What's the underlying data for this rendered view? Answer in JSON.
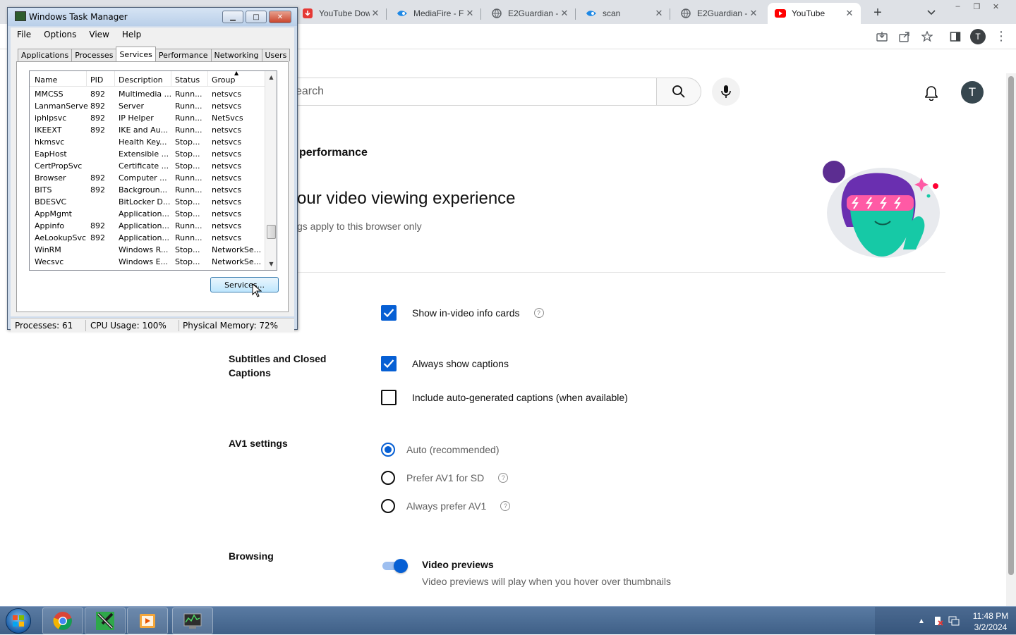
{
  "browser": {
    "tabs": [
      {
        "label": "YouTube Dow",
        "icon": "youtube-downloader-icon"
      },
      {
        "label": "MediaFire - F",
        "icon": "mediafire-icon"
      },
      {
        "label": "E2Guardian -",
        "icon": "globe-icon"
      },
      {
        "label": "scan",
        "icon": "mediafire-icon"
      },
      {
        "label": "E2Guardian -",
        "icon": "globe-icon"
      },
      {
        "label": "YouTube",
        "icon": "youtube-icon",
        "active": true
      }
    ],
    "new_tab": "+",
    "profile_initial": "T",
    "window_controls": [
      "–",
      "❐",
      "✕"
    ]
  },
  "youtube": {
    "search_placeholder": "earch",
    "avatar_initial": "T",
    "section_title": "performance",
    "heading": "our video viewing experience",
    "subheading": "gs apply to this browser only",
    "groups": {
      "subtitles_label": "Subtitles and Closed Captions",
      "av1_label": "AV1 settings",
      "browsing_label": "Browsing"
    },
    "options": {
      "info_cards": {
        "label": "Show in-video info cards",
        "checked": true
      },
      "always_captions": {
        "label": "Always show captions",
        "checked": true
      },
      "auto_captions": {
        "label": "Include auto-generated captions (when available)",
        "checked": false
      },
      "av1_auto": {
        "label": "Auto (recommended)",
        "selected": true
      },
      "av1_sd": {
        "label": "Prefer AV1 for SD",
        "selected": false
      },
      "av1_always": {
        "label": "Always prefer AV1",
        "selected": false
      },
      "video_previews": {
        "title": "Video previews",
        "desc": "Video previews will play when you hover over thumbnails",
        "on": true
      }
    },
    "accent_color": "#065fd4"
  },
  "task_manager": {
    "title": "Windows Task Manager",
    "menu": [
      "File",
      "Options",
      "View",
      "Help"
    ],
    "tabs": [
      "Applications",
      "Processes",
      "Services",
      "Performance",
      "Networking",
      "Users"
    ],
    "active_tab": "Services",
    "columns": [
      "Name",
      "PID",
      "Description",
      "Status",
      "Group"
    ],
    "rows": [
      [
        "MMCSS",
        "892",
        "Multimedia ...",
        "Runn...",
        "netsvcs"
      ],
      [
        "LanmanServer",
        "892",
        "Server",
        "Runn...",
        "netsvcs"
      ],
      [
        "iphlpsvc",
        "892",
        "IP Helper",
        "Runn...",
        "NetSvcs"
      ],
      [
        "IKEEXT",
        "892",
        "IKE and Au...",
        "Runn...",
        "netsvcs"
      ],
      [
        "hkmsvc",
        "",
        "Health Key...",
        "Stop...",
        "netsvcs"
      ],
      [
        "EapHost",
        "",
        "Extensible ...",
        "Stop...",
        "netsvcs"
      ],
      [
        "CertPropSvc",
        "",
        "Certificate ...",
        "Stop...",
        "netsvcs"
      ],
      [
        "Browser",
        "892",
        "Computer ...",
        "Runn...",
        "netsvcs"
      ],
      [
        "BITS",
        "892",
        "Backgroun...",
        "Runn...",
        "netsvcs"
      ],
      [
        "BDESVC",
        "",
        "BitLocker D...",
        "Stop...",
        "netsvcs"
      ],
      [
        "AppMgmt",
        "",
        "Application...",
        "Stop...",
        "netsvcs"
      ],
      [
        "Appinfo",
        "892",
        "Application...",
        "Runn...",
        "netsvcs"
      ],
      [
        "AeLookupSvc",
        "892",
        "Application...",
        "Runn...",
        "netsvcs"
      ],
      [
        "WinRM",
        "",
        "Windows R...",
        "Stop...",
        "NetworkSe..."
      ],
      [
        "Wecsvc",
        "",
        "Windows E...",
        "Stop...",
        "NetworkSe..."
      ]
    ],
    "services_button": "Services...",
    "status": {
      "processes": "Processes: 61",
      "cpu": "CPU Usage: 100%",
      "memory": "Physical Memory: 72%"
    }
  },
  "taskbar": {
    "pinned": [
      "chrome-icon",
      "video-editor-icon",
      "media-player-icon",
      "task-manager-icon"
    ],
    "clock_time": "11:48 PM",
    "clock_date": "3/2/2024"
  }
}
